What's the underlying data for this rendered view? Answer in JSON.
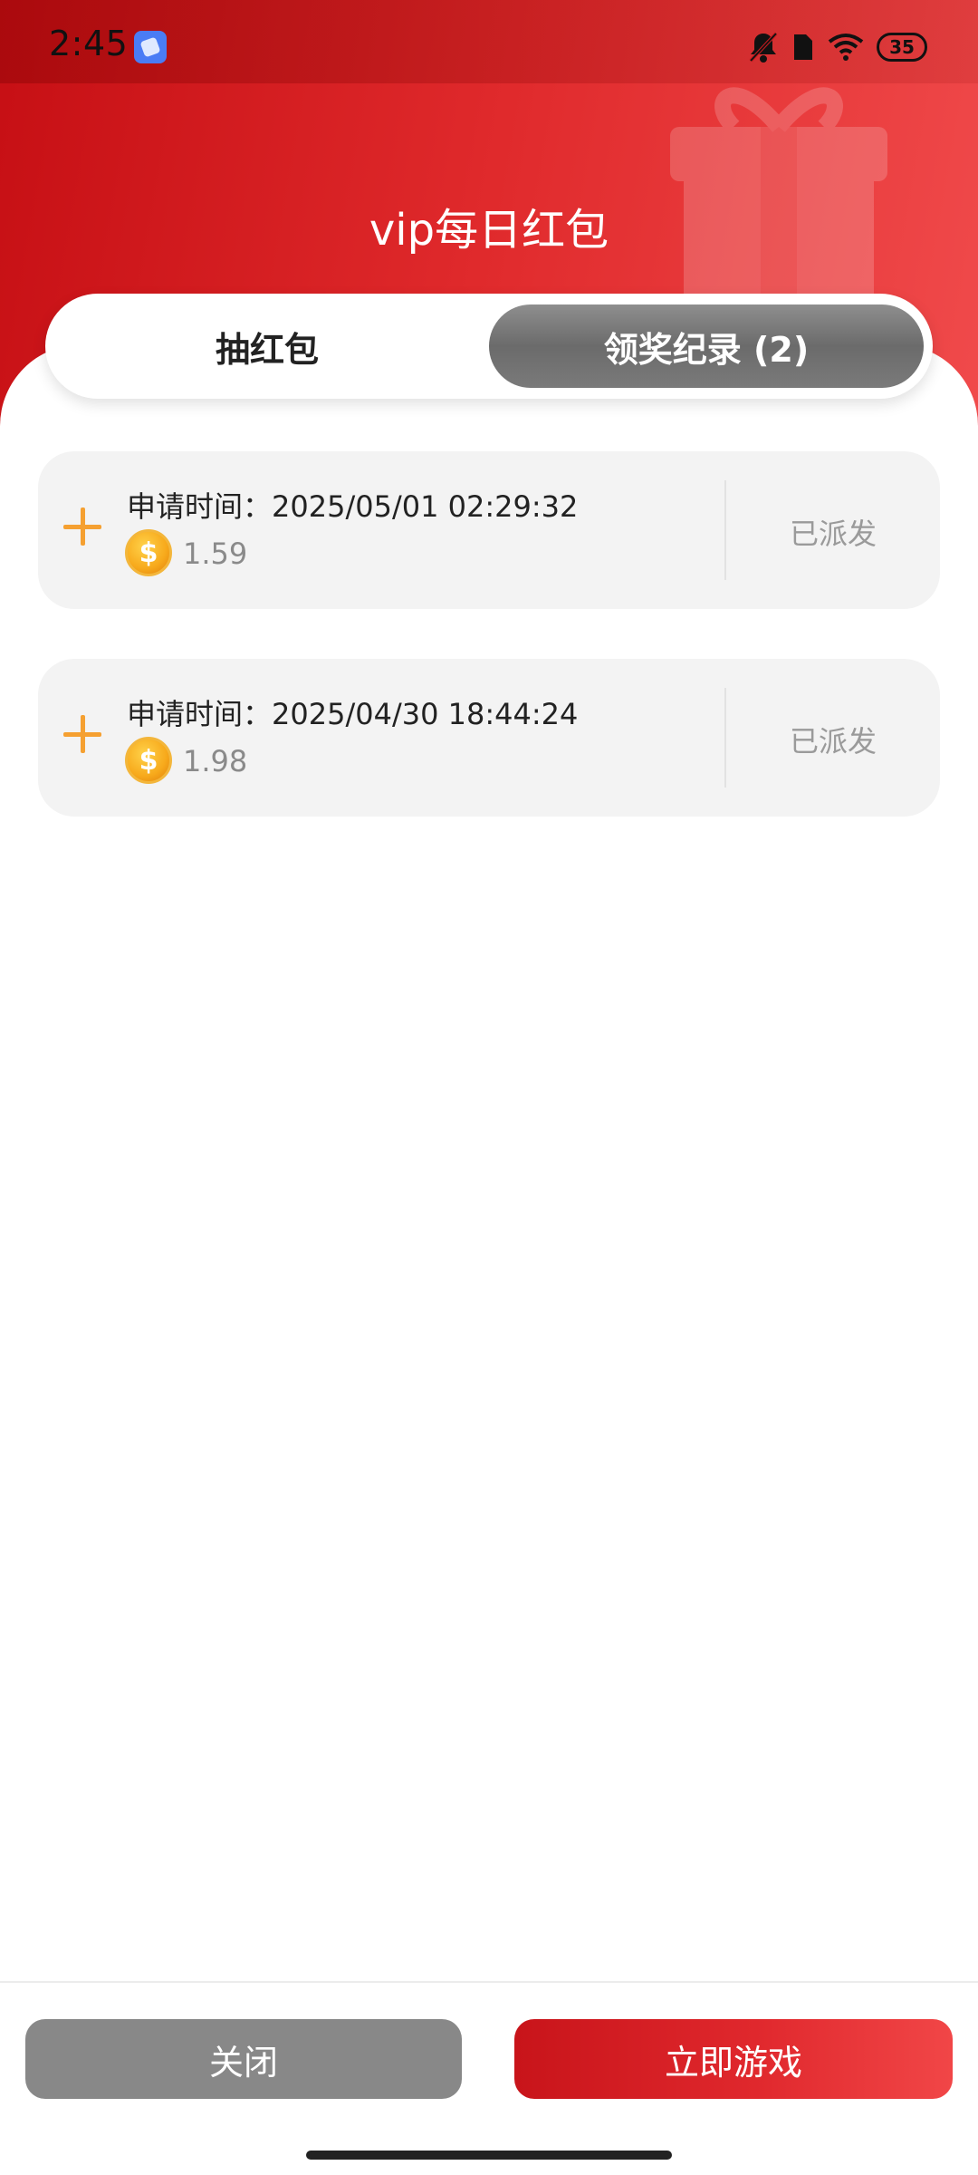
{
  "status_bar": {
    "time": "2:45",
    "battery": "35",
    "icons": [
      "app-icon",
      "silent-bell-icon",
      "sim-card-icon",
      "wifi-icon",
      "battery-icon"
    ]
  },
  "header": {
    "title": "vip每日红包"
  },
  "tabs": [
    {
      "label": "抽红包",
      "active": false
    },
    {
      "label": "领奖纪录 (2)",
      "active": true
    }
  ],
  "records": [
    {
      "time_label": "申请时间：",
      "time_value": "2025/05/01 02:29:32",
      "amount": "1.59",
      "status": "已派发"
    },
    {
      "time_label": "申请时间：",
      "time_value": "2025/04/30 18:44:24",
      "amount": "1.98",
      "status": "已派发"
    }
  ],
  "footer": {
    "close_label": "关闭",
    "play_label": "立即游戏"
  },
  "colors": {
    "brand_red": "#e0282d",
    "coin_gold": "#f7a91b",
    "plus_orange": "#f5a031",
    "close_gray": "#888888"
  }
}
